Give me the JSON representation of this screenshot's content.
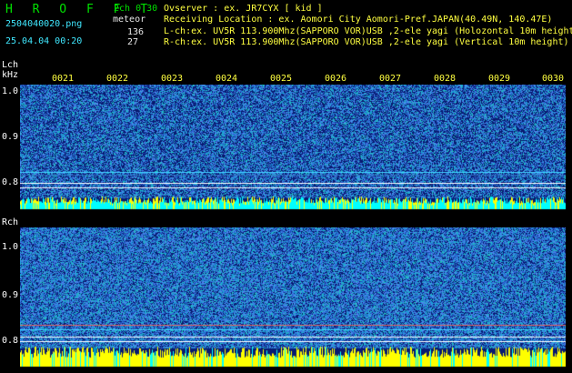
{
  "header": {
    "logo": "H R O F F T",
    "version": "2ch 0.30",
    "mode": "meteor",
    "filename": "2504040020.png",
    "datetime": "25.04.04 00:20",
    "lch_count": "136",
    "rch_count": "27",
    "observer_line": "Ovserver              : ex. JR7CYX [ kid ]",
    "location_line": "Receiving Location : ex. Aomori City Aomori-Pref.JAPAN(40.49N, 140.47E)",
    "lch_line": "L-ch:ex. UV5R 113.900Mhz(SAPPORO VOR)USB ,2-ele yagi (Holozontal 10m height",
    "rch_line": "R-ch:ex. UV5R 113.900Mhz(SAPPORO VOR)USB ,2-ele yagi (Vertical 10m height)"
  },
  "lch": {
    "label": "Lch",
    "unit": "kHz",
    "ticks": [
      "1.0",
      "0.9",
      "0.8"
    ]
  },
  "rch": {
    "label": "Rch",
    "ticks": [
      "1.0",
      "0.9",
      "0.8"
    ]
  },
  "time_ticks": [
    "0021",
    "0022",
    "0023",
    "0024",
    "0025",
    "0026",
    "0027",
    "0028",
    "0029",
    "0030"
  ],
  "colors": {
    "background": "#000000",
    "spectrum_dark": "#0a1a66",
    "spectrum_noise": "#2a60c8",
    "amplitude_yellow": "#ffff00",
    "amplitude_cyan": "#00ffff",
    "header_green": "#00e000"
  }
}
